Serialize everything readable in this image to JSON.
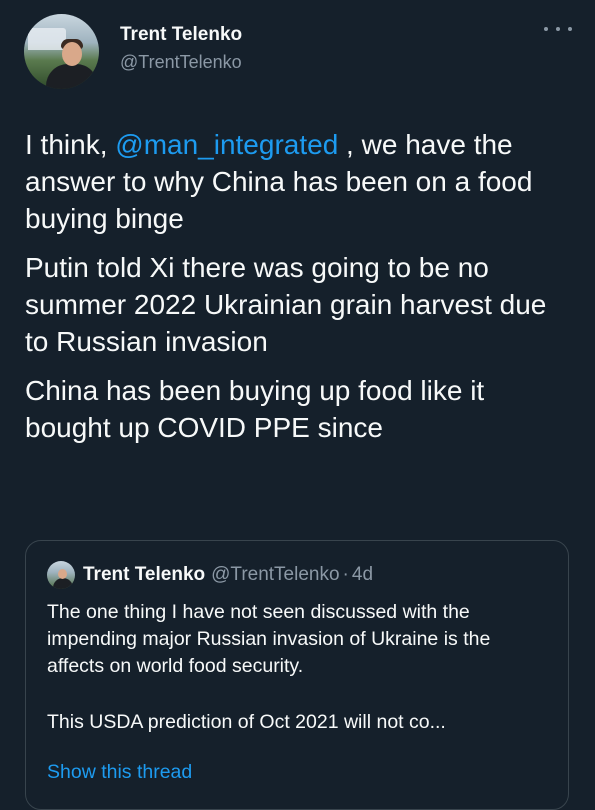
{
  "author": {
    "display_name": "Trent Telenko",
    "handle": "@TrentTelenko"
  },
  "tweet": {
    "line1_prefix": "I think, ",
    "mention": "@man_integrated",
    "line1_suffix": " , we have the answer to why China has been on a food buying binge",
    "paragraph2": "Putin told Xi there was going to be no summer 2022 Ukrainian grain harvest due to Russian invasion",
    "paragraph3": "China has been buying up food like it bought up COVID PPE since"
  },
  "quoted_tweet": {
    "display_name": "Trent Telenko",
    "handle": "@TrentTelenko",
    "separator": "·",
    "time": "4d",
    "paragraph1": "The one thing I have not seen discussed with the impending major Russian invasion of Ukraine is the affects on world food security.",
    "paragraph2": "This USDA prediction of Oct 2021 will not co...",
    "show_thread_label": "Show this thread"
  },
  "icons": {
    "more": "more-options-icon",
    "avatar": "avatar"
  },
  "colors": {
    "background": "#15202b",
    "text": "#f7f9f9",
    "secondary_text": "#8b98a5",
    "link": "#1d9bf0",
    "border": "#38444d"
  }
}
